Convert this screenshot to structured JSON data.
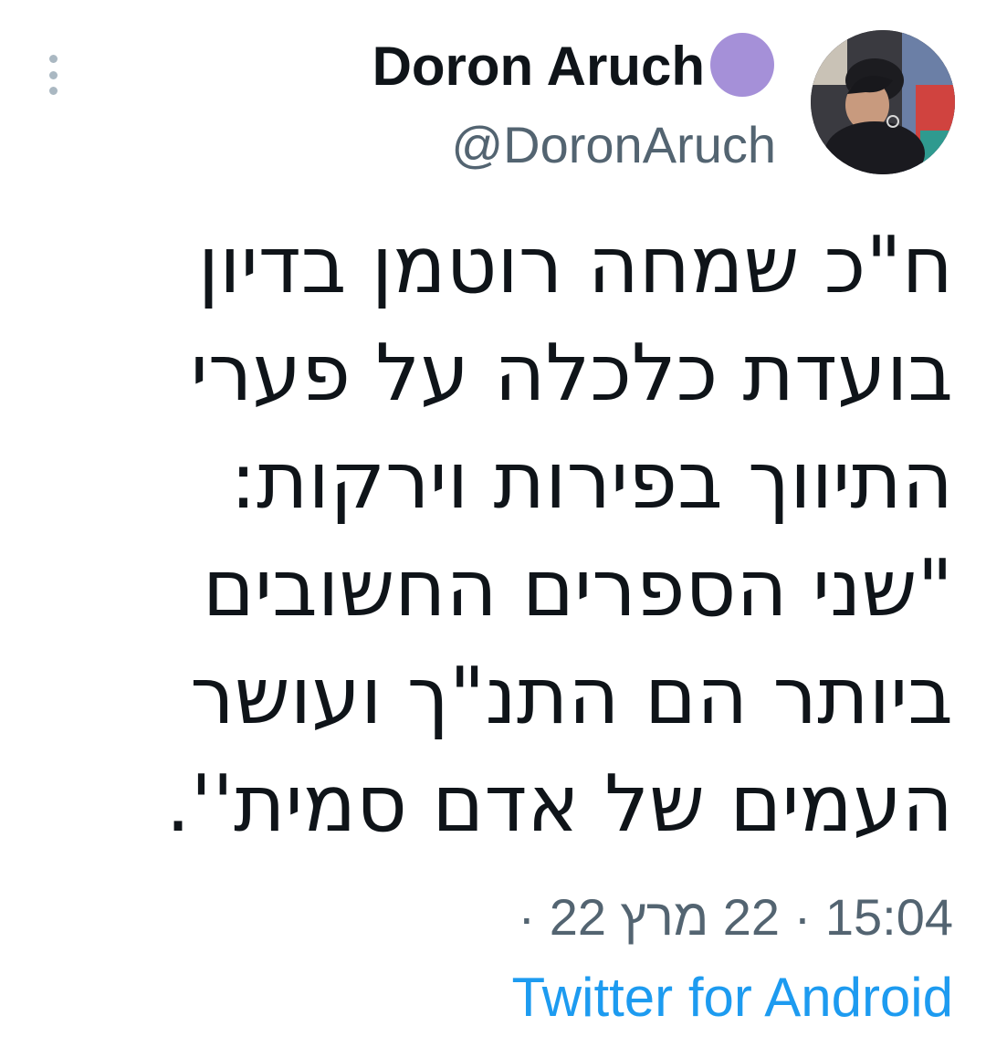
{
  "colors": {
    "text_primary": "#0f1419",
    "text_secondary": "#536471",
    "link": "#1d9bf0",
    "badge": "#a590d8"
  },
  "header": {
    "more_icon": "more-vertical-icon",
    "display_name": "Doron Aruch",
    "badge_icon": "purple-circle-icon",
    "handle": "@DoronAruch",
    "avatar": "profile-photo"
  },
  "tweet": {
    "lines": [
      "ח\"כ שמחה רוטמן בדיון",
      "בועדת כלכלה על פערי",
      "התיווך בפירות וירקות:",
      "\"שני הספרים החשובים",
      "ביותר הם התנ\"ך ועושר",
      "העמים של אדם סמית''."
    ]
  },
  "meta": {
    "time": "15:04",
    "separator": "·",
    "date": "22 מרץ 22",
    "trailing_separator": "·",
    "source": "Twitter for Android"
  }
}
